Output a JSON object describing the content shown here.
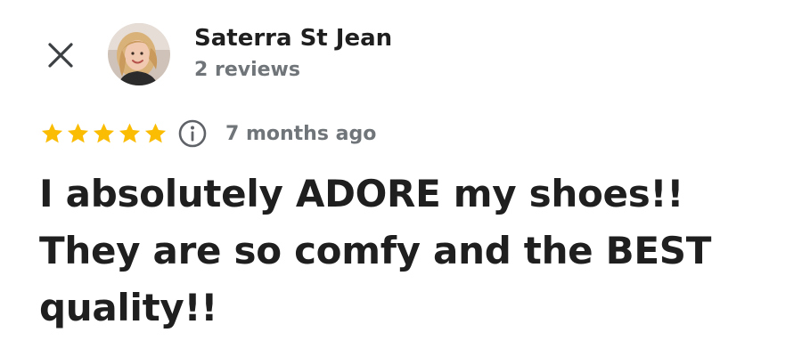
{
  "header": {
    "close_icon": "close-icon",
    "reviewer_name": "Saterra St Jean",
    "review_count": "2 reviews"
  },
  "review": {
    "rating": 5,
    "rating_max": 5,
    "star_color": "#fbbc04",
    "info_icon": "info-icon",
    "time_ago": "7 months ago",
    "text": "I absolutely ADORE my shoes!! They are so comfy and the BEST quality!!"
  }
}
